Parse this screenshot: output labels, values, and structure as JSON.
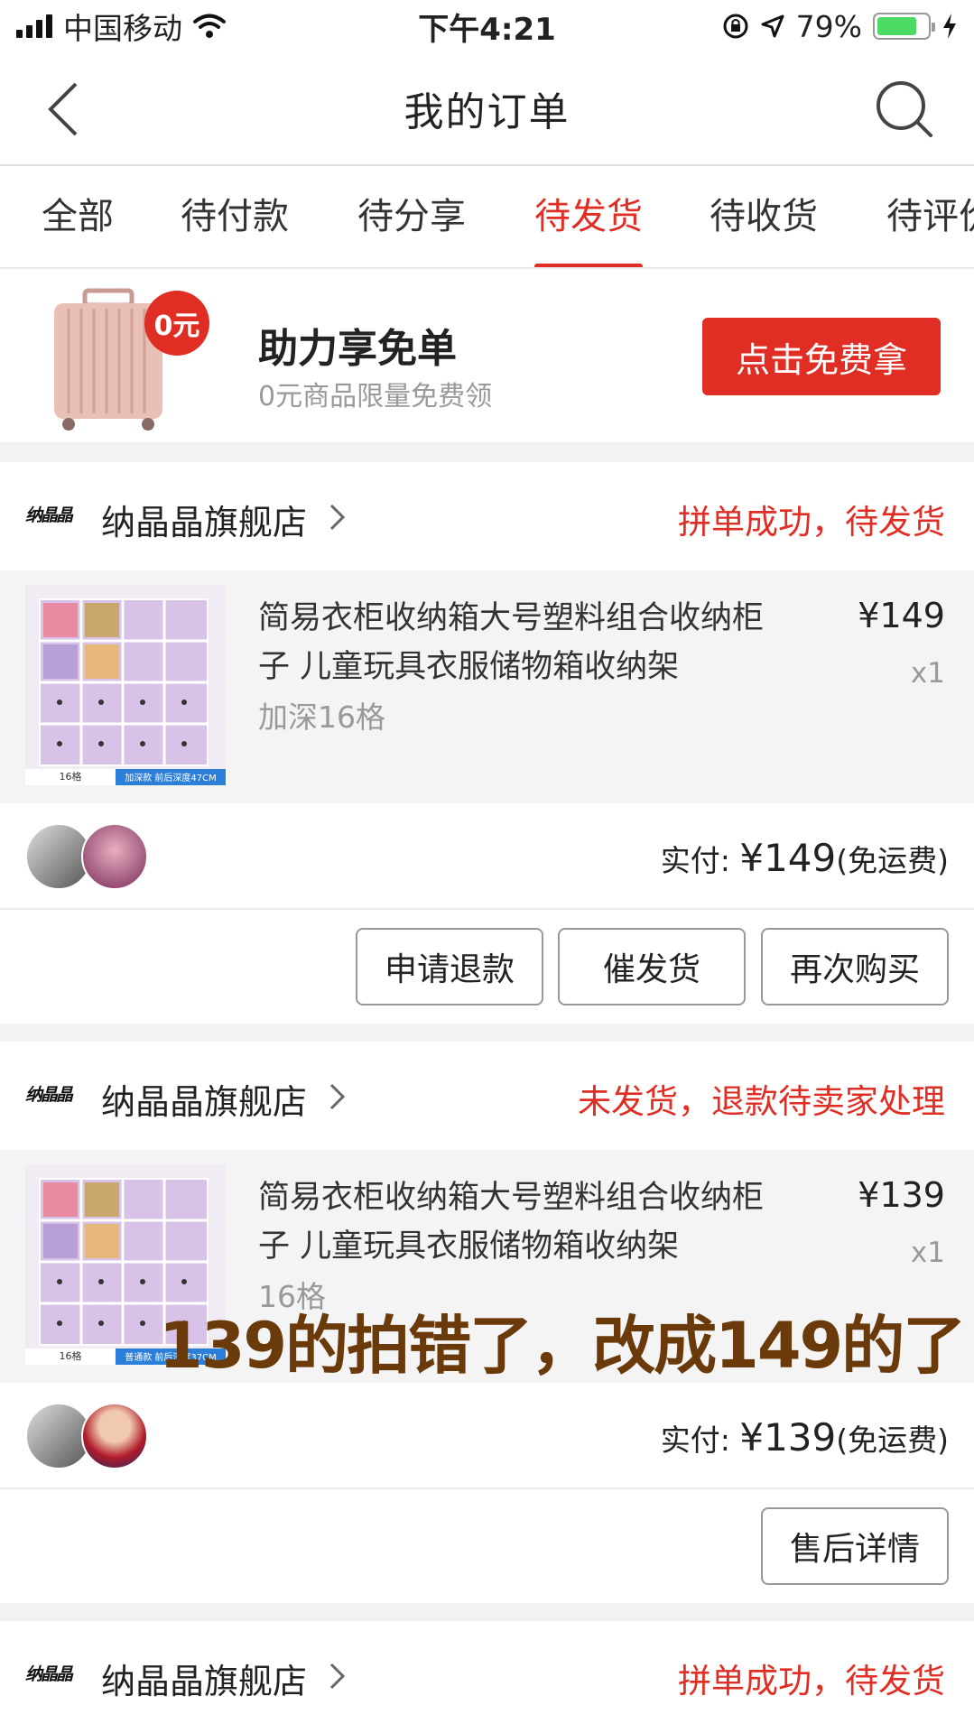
{
  "status_bar": {
    "carrier": "中国移动",
    "time": "下午4:21",
    "battery_percent": "79%",
    "battery_level": 0.79,
    "icons": [
      "signal-icon",
      "wifi-icon",
      "rotation-lock-icon",
      "location-icon",
      "battery-icon",
      "charging-icon"
    ]
  },
  "nav": {
    "title": "我的订单",
    "back_icon": "back-chevron-icon",
    "search_icon": "search-icon"
  },
  "tabs": [
    {
      "label": "全部",
      "active": false
    },
    {
      "label": "待付款",
      "active": false
    },
    {
      "label": "待分享",
      "active": false
    },
    {
      "label": "待发货",
      "active": true
    },
    {
      "label": "待收货",
      "active": false
    },
    {
      "label": "待评价",
      "active": false
    }
  ],
  "promo": {
    "badge": "0元",
    "title": "助力享免单",
    "subtitle": "0元商品限量免费领",
    "button": "点击免费拿"
  },
  "orders": [
    {
      "shop_logo": "纳晶晶",
      "shop_name": "纳晶晶旗舰店",
      "status": "拼单成功，待发货",
      "item": {
        "title": "简易衣柜收纳箱大号塑料组合收纳柜子 儿童玩具衣服储物箱收纳架",
        "spec": "加深16格",
        "price": "¥149",
        "qty": "x1",
        "thumb_caption_left": "16格",
        "thumb_caption_right": "加深款 前后深度47CM"
      },
      "payment": {
        "label": "实付: ",
        "amount": "¥149",
        "note": "(免运费)"
      },
      "actions": [
        "申请退款",
        "催发货",
        "再次购买"
      ]
    },
    {
      "shop_logo": "纳晶晶",
      "shop_name": "纳晶晶旗舰店",
      "status": "未发货，退款待卖家处理",
      "item": {
        "title": "简易衣柜收纳箱大号塑料组合收纳柜子 儿童玩具衣服储物箱收纳架",
        "spec": "16格",
        "price": "¥139",
        "qty": "x1",
        "thumb_caption_left": "16格",
        "thumb_caption_right": "普通款 前后深度37CM"
      },
      "payment": {
        "label": "实付: ",
        "amount": "¥139",
        "note": "(免运费)"
      },
      "actions": [
        "售后详情"
      ]
    },
    {
      "shop_logo": "纳晶晶",
      "shop_name": "纳晶晶旗舰店",
      "status": "拼单成功，待发货"
    }
  ],
  "annotation": "139的拍错了，改成149的了",
  "colors": {
    "accent": "#e02e24",
    "overlay_text": "#6a3a0a",
    "battery": "#4cd964"
  }
}
